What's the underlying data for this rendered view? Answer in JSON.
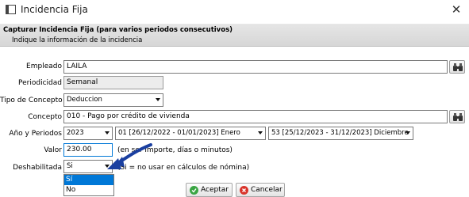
{
  "window": {
    "title": "Incidencia Fija",
    "close_glyph": "✕"
  },
  "header": {
    "title": "Capturar Incidencia Fija (para varios periodos consecutivos)",
    "subtitle": "Indique la información de la incidencia"
  },
  "form": {
    "empleado": {
      "label": "Empleado",
      "value": "LAILA"
    },
    "periodicidad": {
      "label": "Periodicidad",
      "value": "Semanal"
    },
    "tipo_concepto": {
      "label": "Tipo de Concepto",
      "value": "Deduccion"
    },
    "concepto": {
      "label": "Concepto",
      "value": "010 - Pago por crédito de vivienda"
    },
    "anio_periodos": {
      "label": "Año y Periodos",
      "year": "2023",
      "period_start": "01 [26/12/2022 - 01/01/2023] Enero",
      "period_end": "53 [25/12/2023 - 31/12/2023] Diciembre"
    },
    "valor": {
      "label": "Valor",
      "value": "230.00",
      "hint": "(en ser importe, días o minutos)"
    },
    "deshabilitada": {
      "label": "Deshabilitada",
      "value": "Si",
      "hint": "(Si = no usar en cálculos de nómina)",
      "options": [
        "Sí",
        "No"
      ]
    }
  },
  "buttons": {
    "accept": "Aceptar",
    "cancel": "Cancelar"
  },
  "icons": {
    "window": "window-icon",
    "search": "binoculars-icon",
    "accept": "check-icon",
    "cancel": "cancel-icon"
  },
  "colors": {
    "selection": "#0078d7",
    "accept": "#3aa543",
    "cancel": "#d9342b"
  }
}
